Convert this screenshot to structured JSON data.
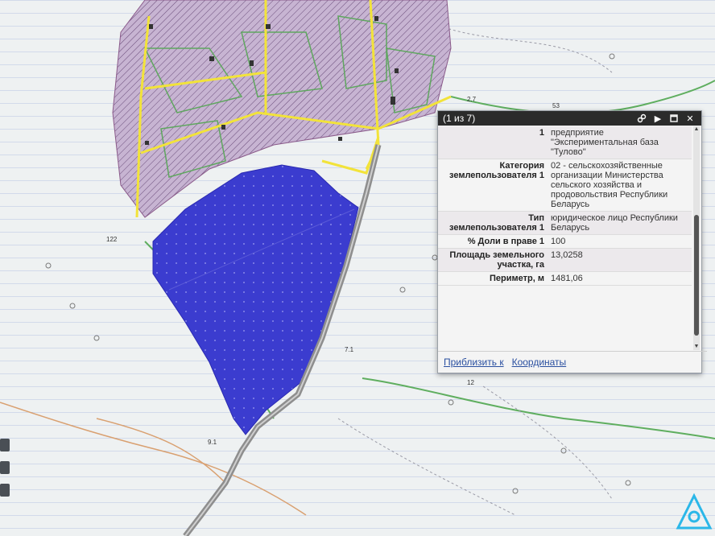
{
  "popup": {
    "title": "(1 из 7)",
    "rows": [
      {
        "key": "1",
        "value": "предприятие \"Экспериментальная база \"Тулово\""
      },
      {
        "key": "Категория землепользователя 1",
        "value": "02 - сельскохозяйственные организации Министерства сельского хозяйства и продовольствия Республики Беларусь"
      },
      {
        "key": "Тип землепользователя 1",
        "value": "юридическое лицо Республики Беларусь"
      },
      {
        "key": "% Доли в праве 1",
        "value": "100"
      },
      {
        "key": "Площадь земельного участка, га",
        "value": "13,0258"
      },
      {
        "key": "Периметр, м",
        "value": "1481,06"
      }
    ],
    "footer": {
      "zoom_link": "Приблизить к",
      "coords_link": "Координаты"
    },
    "icons": [
      "link-icon",
      "play-icon",
      "maximize-icon",
      "close-icon"
    ]
  },
  "map": {
    "labels": {
      "l1": "2.7",
      "l2": "53",
      "l3": "7.1",
      "l4": "12",
      "l5": "122",
      "l6": "9.1"
    },
    "colors": {
      "parcel": "#3a3ad0",
      "settlement": "#b9a3c9",
      "roads": "#f2e33a",
      "road": "#9a9a9a",
      "contour": "#5fae5f"
    }
  }
}
